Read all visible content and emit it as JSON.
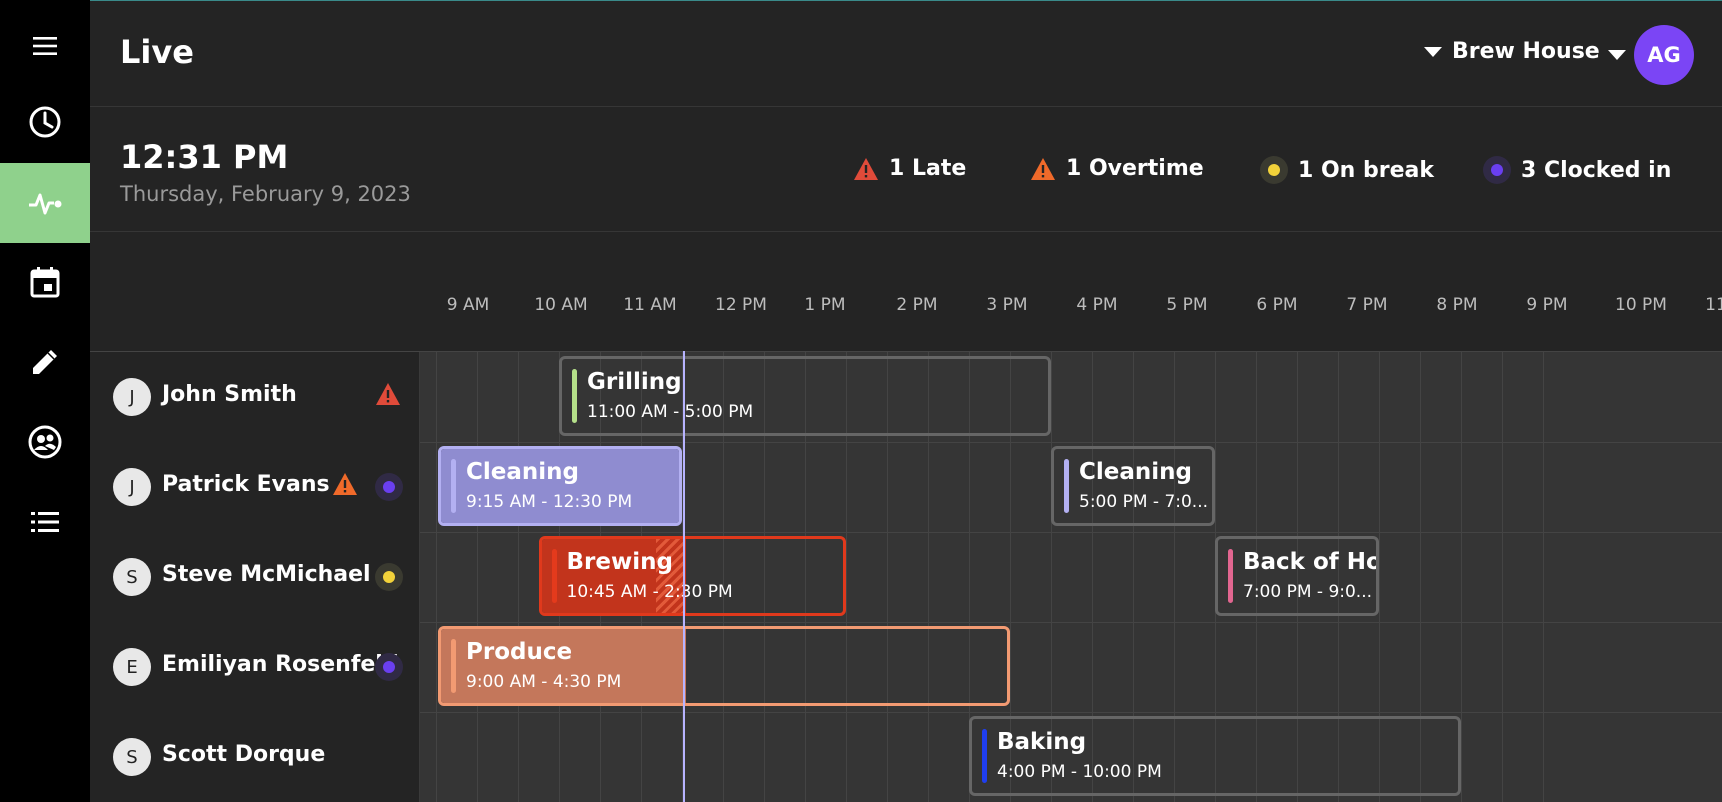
{
  "nav": {
    "items": [
      {
        "name": "nav-timeclock",
        "icon": "clock-icon",
        "active": false
      },
      {
        "name": "nav-live",
        "icon": "pulse-icon",
        "active": true
      },
      {
        "name": "nav-schedule",
        "icon": "calendar-icon",
        "active": false
      },
      {
        "name": "nav-edit",
        "icon": "pencil-icon",
        "active": false
      },
      {
        "name": "nav-team",
        "icon": "team-icon",
        "active": false
      },
      {
        "name": "nav-list",
        "icon": "list-icon",
        "active": false
      }
    ],
    "accent_color": "#8fd18c"
  },
  "header": {
    "title": "Live",
    "location": "Brew House",
    "user_initials": "AG",
    "avatar_color": "#7b45f5"
  },
  "info": {
    "time": "12:31 PM",
    "date": "Thursday, February 9, 2023",
    "stats": [
      {
        "label": "1 Late",
        "icon": "warning-icon",
        "color": "#e04b3a"
      },
      {
        "label": "1 Overtime",
        "icon": "warning-icon",
        "color": "#f06a2a"
      },
      {
        "label": "1 On break",
        "icon": "dot-icon",
        "color": "#f2d23a"
      },
      {
        "label": "3 Clocked in",
        "icon": "dot-icon",
        "color": "#6a3ff0"
      }
    ]
  },
  "timeline": {
    "hours": [
      "9 AM",
      "10 AM",
      "11 AM",
      "12 PM",
      "1 PM",
      "2 PM",
      "3 PM",
      "4 PM",
      "5 PM",
      "6 PM",
      "7 PM",
      "8 PM",
      "9 PM",
      "10 PM",
      "11"
    ],
    "now": "12:31 PM"
  },
  "employees": [
    {
      "initial": "J",
      "name": "John Smith",
      "late": true,
      "overtime": false,
      "status": null
    },
    {
      "initial": "J",
      "name": "Patrick Evans",
      "late": false,
      "overtime": true,
      "status": "clocked-in"
    },
    {
      "initial": "S",
      "name": "Steve McMichael",
      "late": false,
      "overtime": false,
      "status": "on-break"
    },
    {
      "initial": "E",
      "name": "Emiliyan Rosenfeld",
      "late": false,
      "overtime": false,
      "status": "clocked-in"
    },
    {
      "initial": "S",
      "name": "Scott Dorque",
      "late": false,
      "overtime": false,
      "status": null
    }
  ],
  "shifts": [
    {
      "row": 0,
      "title": "Grilling",
      "time": "11:00 AM - 5:00 PM",
      "start": 11.0,
      "end": 17.0,
      "stripe": "#b5e08a",
      "fill": null
    },
    {
      "row": 1,
      "title": "Cleaning",
      "time": "9:15 AM - 12:30 PM",
      "start": 9.0,
      "end": 12.5,
      "stripe": "#b3b0f2",
      "fill": "#8f8cd0",
      "border": "#b3b0f2"
    },
    {
      "row": 1,
      "title": "Cleaning",
      "time": "5:00 PM - 7:0...",
      "start": 17.0,
      "end": 19.0,
      "stripe": "#b3b0f2",
      "fill": null
    },
    {
      "row": 2,
      "title": "Brewing",
      "time": "10:45 AM - 2:30 PM",
      "start": 10.75,
      "end": 14.5,
      "stripe": "#e43a1c",
      "fill": "#c2341c",
      "border": "#e0391c",
      "break": true
    },
    {
      "row": 2,
      "title": "Back of Ho...",
      "time": "7:00 PM - 9:0...",
      "start": 19.0,
      "end": 21.0,
      "stripe": "#e26690",
      "fill": null
    },
    {
      "row": 3,
      "title": "Produce",
      "time": "9:00 AM - 4:30 PM",
      "start": 9.0,
      "end": 16.5,
      "stripe": "#f29a72",
      "fill": "#c4775b",
      "border": "#f29a72"
    },
    {
      "row": 4,
      "title": "Baking",
      "time": "4:00 PM - 10:00 PM",
      "start": 16.0,
      "end": 22.0,
      "stripe": "#1f3ef0",
      "fill": null
    }
  ]
}
